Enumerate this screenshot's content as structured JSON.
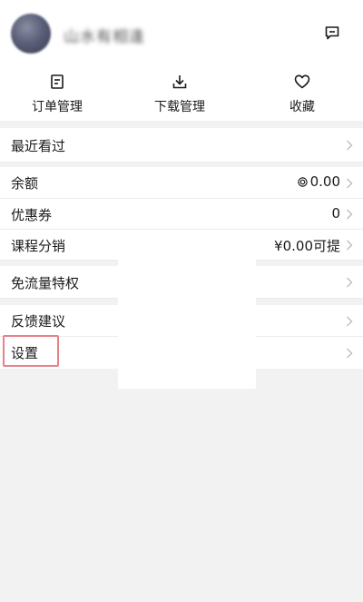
{
  "header": {
    "username": "山水有相逢",
    "message_icon": "message-icon"
  },
  "shortcuts": [
    {
      "label": "订单管理",
      "icon": "order-icon"
    },
    {
      "label": "下载管理",
      "icon": "download-icon"
    },
    {
      "label": "收藏",
      "icon": "heart-icon"
    }
  ],
  "menu": {
    "recent": {
      "label": "最近看过"
    },
    "balance": {
      "label": "余额",
      "value": "0.00"
    },
    "coupon": {
      "label": "优惠券",
      "value": "0"
    },
    "distribution": {
      "label": "课程分销",
      "value": "¥0.00可提"
    },
    "free_traffic": {
      "label": "免流量特权"
    },
    "feedback": {
      "label": "反馈建议"
    },
    "settings": {
      "label": "设置"
    }
  },
  "colors": {
    "highlight": "#e7828a",
    "background": "#f2f2f2"
  }
}
